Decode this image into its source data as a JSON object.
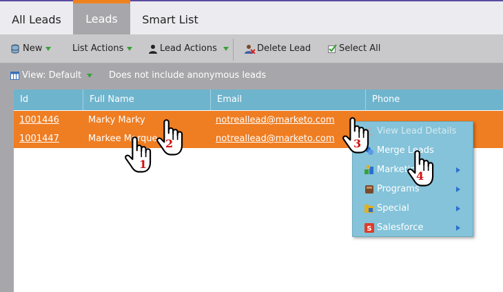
{
  "tabs": [
    {
      "label": "All Leads",
      "active": false
    },
    {
      "label": "Leads",
      "active": true
    },
    {
      "label": "Smart List",
      "active": false
    }
  ],
  "toolbar": {
    "new_label": "New",
    "list_actions_label": "List Actions",
    "lead_actions_label": "Lead Actions",
    "delete_lead_label": "Delete Lead",
    "select_all_label": "Select All"
  },
  "viewbar": {
    "view_label": "View: Default",
    "note": "Does not include anonymous leads"
  },
  "table": {
    "columns": [
      "Id",
      "Full Name",
      "Email",
      "Phone"
    ],
    "rows": [
      {
        "id": "1001446",
        "name": "Marky Marky",
        "email": "notreallead@marketo.com",
        "phone": ""
      },
      {
        "id": "1001447",
        "name": "Markee Marque",
        "email": "notreallead@marketo.com",
        "phone": ""
      }
    ]
  },
  "context_menu": {
    "items": [
      {
        "label": "View Lead Details",
        "icon": "lead-details-icon",
        "disabled": true,
        "submenu": false
      },
      {
        "label": "Merge Leads",
        "icon": "merge-icon",
        "disabled": false,
        "submenu": false
      },
      {
        "label": "Marketing",
        "icon": "marketing-icon",
        "disabled": false,
        "submenu": true
      },
      {
        "label": "Programs",
        "icon": "programs-icon",
        "disabled": false,
        "submenu": true
      },
      {
        "label": "Special",
        "icon": "special-icon",
        "disabled": false,
        "submenu": true
      },
      {
        "label": "Salesforce",
        "icon": "salesforce-icon",
        "disabled": false,
        "submenu": true
      }
    ]
  },
  "annotations": [
    "1",
    "2",
    "3",
    "4"
  ],
  "colors": {
    "accent_orange": "#ef7d22",
    "header_blue": "#6fb4cd",
    "menu_blue": "#84c3d9",
    "toolbar_gray": "#c9c9cb",
    "badge_red": "#d01010"
  }
}
